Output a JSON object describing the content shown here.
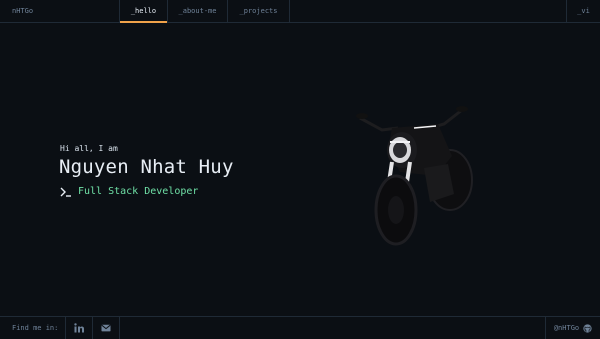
{
  "header": {
    "logo": "nHTGo",
    "tabs": [
      {
        "label": "_hello",
        "active": true
      },
      {
        "label": "_about-me",
        "active": false
      },
      {
        "label": "_projects",
        "active": false
      }
    ],
    "lang": "_vi"
  },
  "hero": {
    "greeting": "Hi all, I am",
    "name": "Nguyen Nhat Huy",
    "role": "Full Stack Developer"
  },
  "footer": {
    "find_label": "Find me in:",
    "social": [
      "linkedin-icon",
      "mail-icon"
    ],
    "handle": "@nHTGo"
  },
  "colors": {
    "background": "#0b0f14",
    "accent": "#f0a24a",
    "role": "#6fe0a6"
  }
}
